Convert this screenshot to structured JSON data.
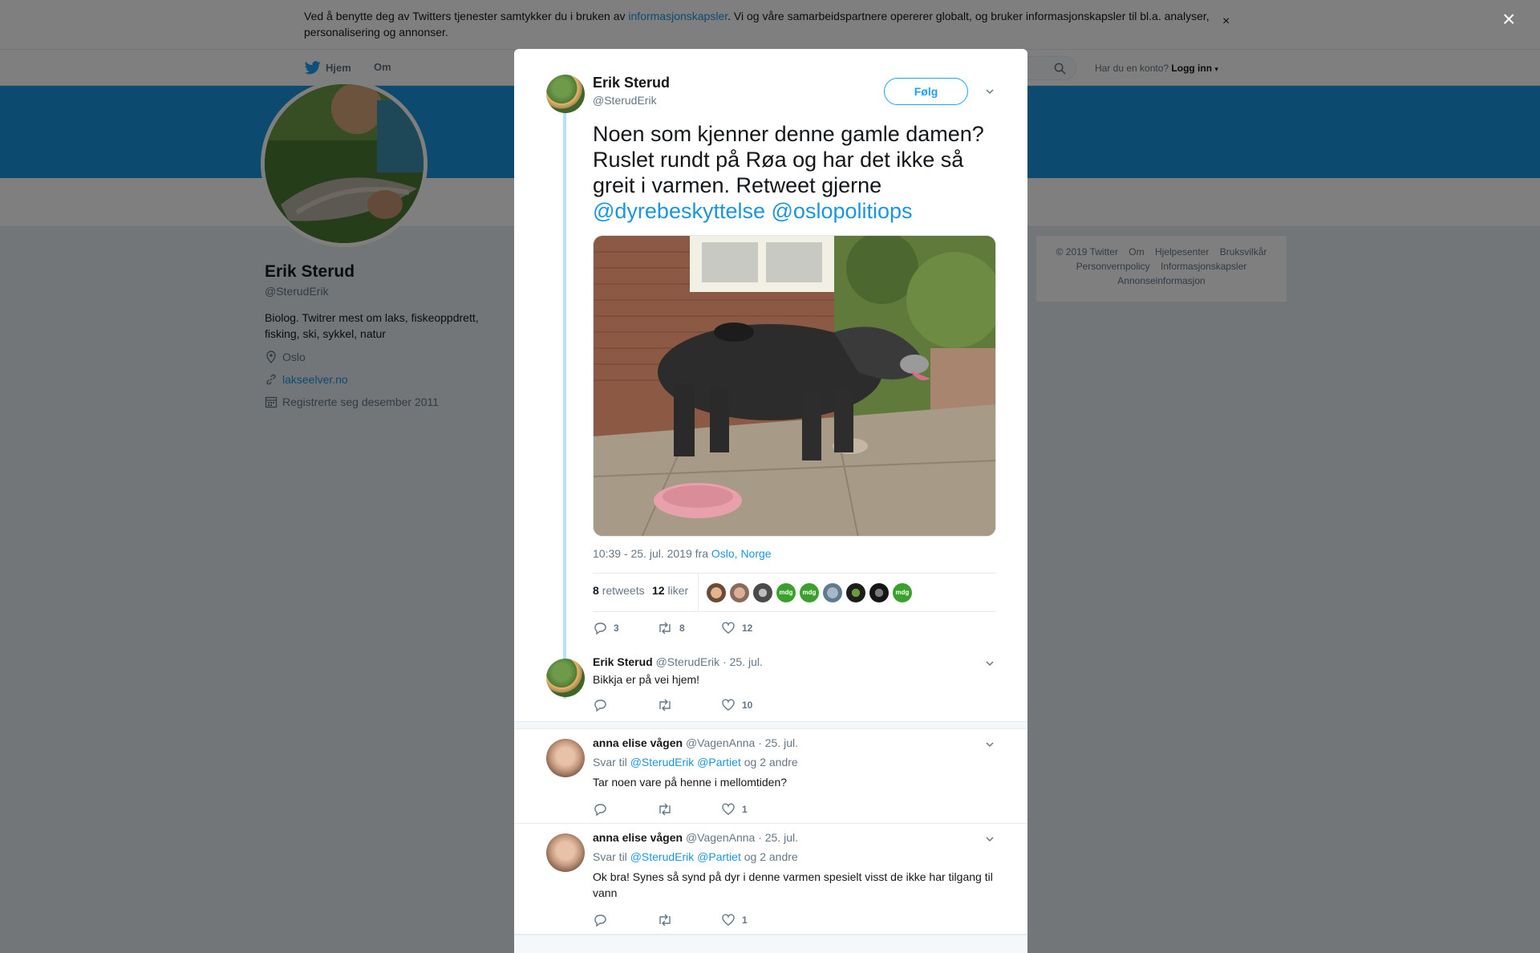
{
  "cookie_bar": {
    "text_before": "Ved å benytte deg av Twitters tjenester samtykker du i bruken av ",
    "link": "informasjonskapsler",
    "text_after": ". Vi og våre samarbeidspartnere opererer globalt, og bruker informasjonskapsler til bl.a. analyser, personalisering og annonser.",
    "close": "×"
  },
  "nav": {
    "home": "Hjem",
    "about": "Om",
    "login_prompt": "Har du en konto?",
    "login": "Logg inn"
  },
  "profile": {
    "name": "Erik Sterud",
    "handle": "@SterudErik",
    "bio": "Biolog. Twitrer mest om laks, fiskeoppdrett, fisking, ski, sykkel, natur",
    "location": "Oslo",
    "website": "lakseelver.no",
    "joined": "Registrerte seg desember 2011"
  },
  "footer": {
    "links": [
      "© 2019 Twitter",
      "Om",
      "Hjelpesenter",
      "Bruksvilkår",
      "Personvernpolicy",
      "Informasjonskapsler",
      "Annonseinformasjon"
    ]
  },
  "overlay_close": "×",
  "tweet": {
    "author_name": "Erik Sterud",
    "author_handle": "@SterudErik",
    "follow_label": "Følg",
    "text": "Noen som kjenner denne gamle damen? Ruslet rundt på Røa og har det ikke så greit i varmen. Retweet gjerne ",
    "mention1": "@dyrebeskyttelse",
    "mention2": "@oslopolitiops",
    "timestamp": "10:39 - 25. jul. 2019 fra ",
    "place": "Oslo, Norge",
    "retweets_count": "8",
    "retweets_label": "retweets",
    "likes_count": "12",
    "likes_label": "liker",
    "mdg_label": "mdg",
    "action_replies": "3",
    "action_retweets": "8",
    "action_likes": "12"
  },
  "replies": [
    {
      "name": "Erik Sterud",
      "handle": "@SterudErik",
      "date": "· 25. jul.",
      "text": "Bikkja er på vei hjem!",
      "likes": "10"
    },
    {
      "name": "anna elise vågen",
      "handle": "@VagenAnna",
      "date": "· 25. jul.",
      "reply_to_label": "Svar til",
      "reply_to_1": "@SterudErik",
      "reply_to_2": "@Partiet",
      "reply_to_more": "og 2 andre",
      "text": "Tar noen vare på henne i mellomtiden?",
      "likes": "1"
    },
    {
      "name": "anna elise vågen",
      "handle": "@VagenAnna",
      "date": "· 25. jul.",
      "reply_to_label": "Svar til",
      "reply_to_1": "@SterudErik",
      "reply_to_2": "@Partiet",
      "reply_to_more": "og 2 andre",
      "text": "Ok bra! Synes så synd på dyr i denne varmen spesielt visst de ikke har tilgang til vann",
      "likes": "1"
    }
  ],
  "colors": {
    "accent": "#1da1f2",
    "link": "#1b95e0",
    "banner": "#1b95e0",
    "mdg_green": "#3aa12c"
  }
}
